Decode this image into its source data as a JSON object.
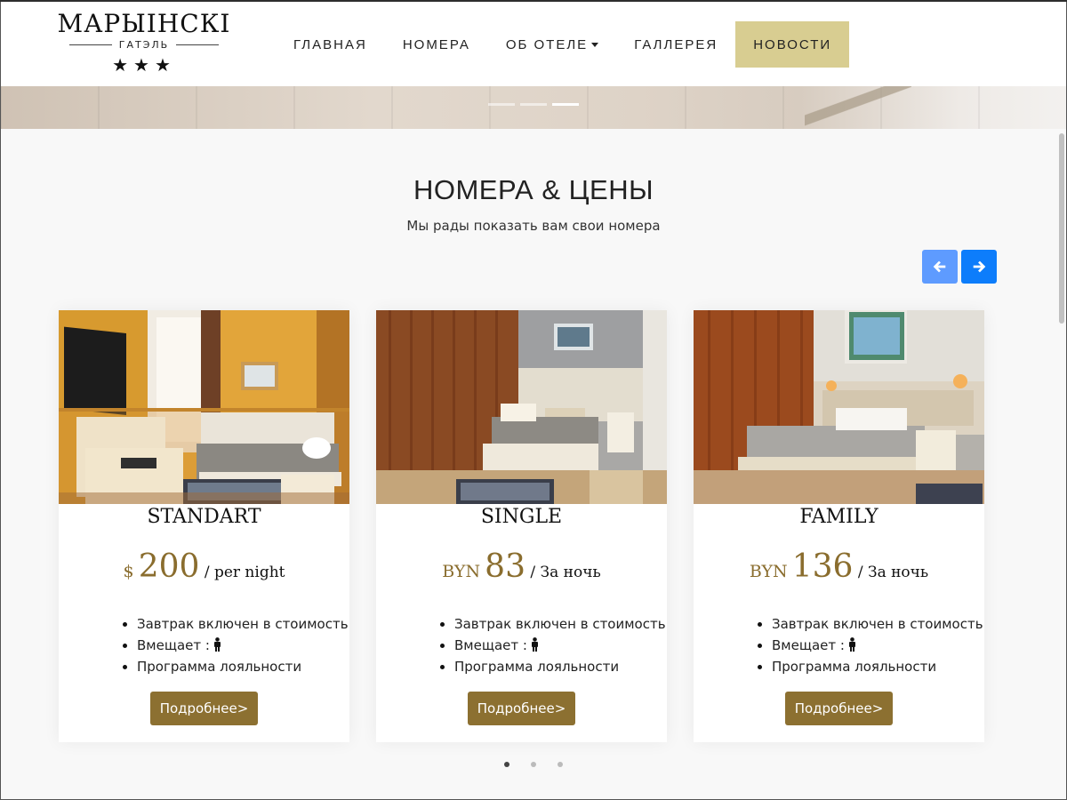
{
  "logo": {
    "title": "МАРЫІНСКІ",
    "subtitle": "ГАТЭЛЬ",
    "stars": "★★★"
  },
  "nav": {
    "items": [
      {
        "label": "ГЛАВНАЯ"
      },
      {
        "label": "НОМЕРА"
      },
      {
        "label": "ОБ ОТЕЛЕ"
      },
      {
        "label": "ГАЛЛЕРЕЯ"
      },
      {
        "label": "НОВОСТИ"
      }
    ],
    "active_item": "НОВОСТИ"
  },
  "hero": {
    "slides_count": 3,
    "active_slide": 3
  },
  "section": {
    "title": "НОМЕРА & ЦЕНЫ",
    "subtitle": "Мы рады показать вам свои номера"
  },
  "carousel": {
    "prev_icon": "arrow-left-icon",
    "next_icon": "arrow-right-icon",
    "pages": 3,
    "active_page": 1
  },
  "rooms": [
    {
      "name": "STANDART",
      "currency": "$",
      "price": "200",
      "per": " / per night",
      "features": [
        "Завтрак включен в стоимость",
        "Вмещает :",
        "Программа лояльности"
      ],
      "button": "Подробнее>"
    },
    {
      "name": "SINGLE",
      "currency": "BYN",
      "price": "83",
      "per": " / За ночь",
      "features": [
        "Завтрак включен в стоимость",
        "Вмещает :",
        "Программа лояльности"
      ],
      "button": "Подробнее>"
    },
    {
      "name": "FAMILY",
      "currency": "BYN",
      "price": "136",
      "per": " / За ночь",
      "features": [
        "Завтрак включен в стоимость",
        "Вмещает :",
        "Программа лояльности"
      ],
      "button": "Подробнее>"
    }
  ],
  "colors": {
    "accent_gold": "#8c7031",
    "nav_active_bg": "#d8cd91",
    "arrow_next": "#0d7dfb",
    "arrow_prev": "#5e9bff"
  }
}
